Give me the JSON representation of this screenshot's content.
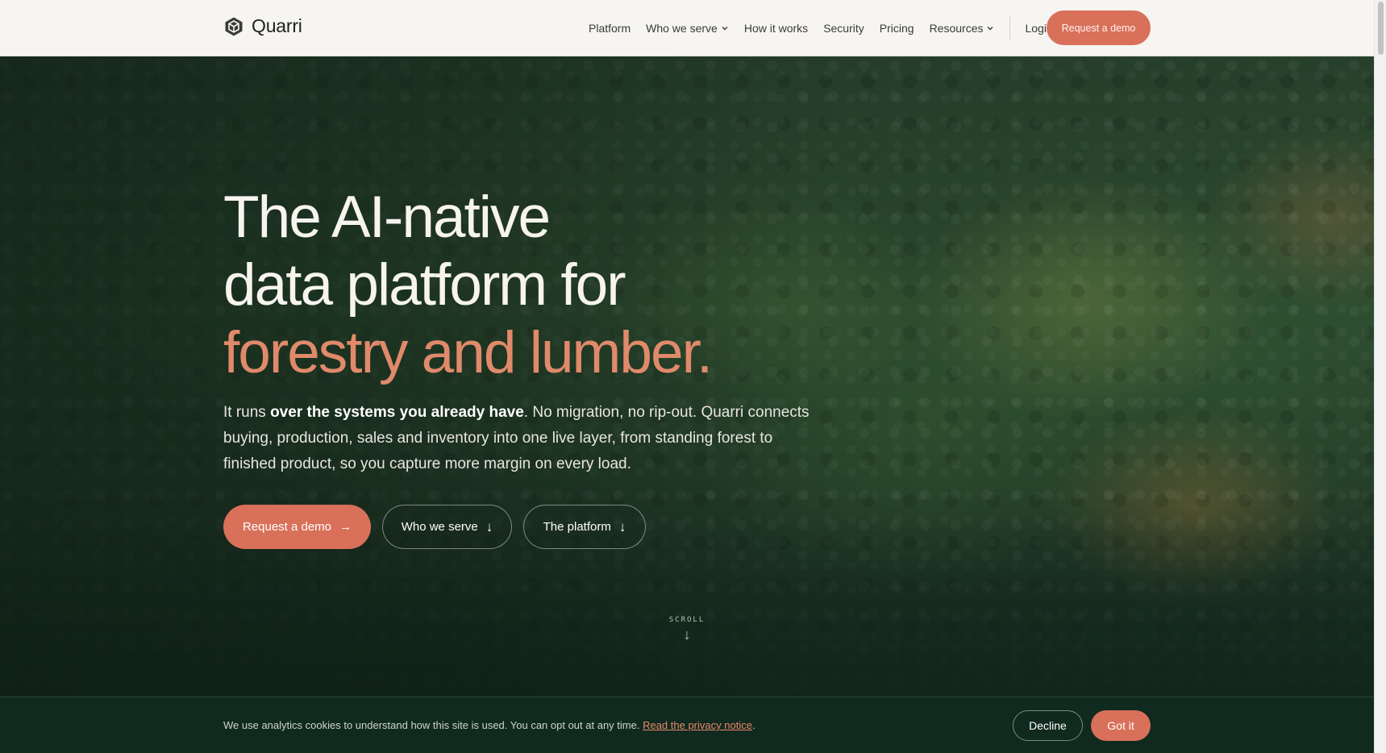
{
  "brand": {
    "name": "Quarri",
    "accent_color": "#d9705a",
    "logo_icon": "hexagon-cube-icon"
  },
  "nav": {
    "items": [
      {
        "label": "Platform",
        "has_dropdown": false
      },
      {
        "label": "Who we serve",
        "has_dropdown": true
      },
      {
        "label": "How it works",
        "has_dropdown": false
      },
      {
        "label": "Security",
        "has_dropdown": false
      },
      {
        "label": "Pricing",
        "has_dropdown": false
      },
      {
        "label": "Resources",
        "has_dropdown": true
      }
    ],
    "login_label": "Login",
    "cta_label": "Request a demo"
  },
  "hero": {
    "title_line1": "The AI-native",
    "title_line2": "data platform for",
    "title_accent": "forestry and lumber.",
    "desc_lead": "It runs ",
    "desc_bold": "over the systems you already have",
    "desc_rest": ". No migration, no rip-out. Quarri connects buying, production, sales and inventory into one live layer, from standing forest to finished product, so you capture more margin on every load.",
    "buttons": {
      "primary": "Request a demo",
      "who": "Who we serve",
      "platform": "The platform"
    },
    "scroll_label": "SCROLL",
    "background": "aerial-forest-canopy"
  },
  "cookie": {
    "text": "We use analytics cookies to understand how this site is used. You can opt out at any time. ",
    "link": "Read the privacy notice",
    "period": ".",
    "decline": "Decline",
    "accept": "Got it"
  }
}
